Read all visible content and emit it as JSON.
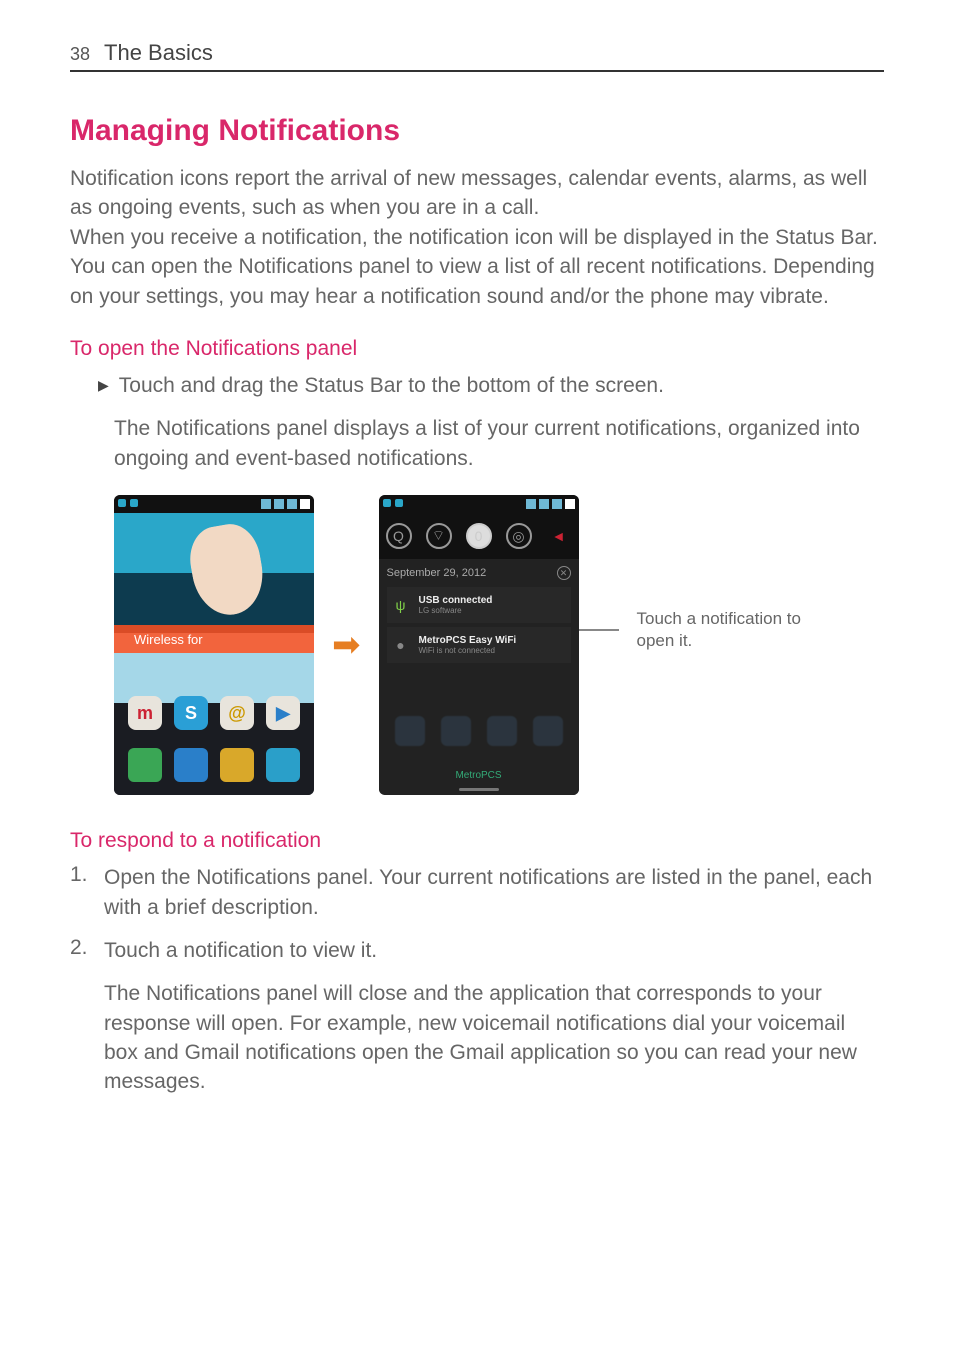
{
  "header": {
    "page_number": "38",
    "chapter": "The Basics"
  },
  "title": "Managing Notifications",
  "intro_para": "Notification icons report the arrival of new messages, calendar events, alarms, as well as ongoing events, such as when you are in a call.\nWhen you receive a notification, the notification icon will be displayed in the Status Bar. You can open the Notifications panel to view a list of all recent notifications. Depending on your settings, you may hear a notification sound and/or the phone may vibrate.",
  "section_open": {
    "heading": "To open the Notifications panel",
    "bullet": "Touch and drag the Status Bar to the bottom of the screen.",
    "followup": "The Notifications panel displays a list of your current notifications, organized into ongoing and event-based notifications."
  },
  "figure": {
    "phone1": {
      "wireless_label": "Wireless for"
    },
    "arrow": "➡",
    "phone2": {
      "date_label": "September 29, 2012",
      "notif1_title": "USB connected",
      "notif1_sub": "LG software",
      "notif2_title": "MetroPCS Easy WiFi",
      "notif2_sub": "WiFi is not connected",
      "carrier": "MetroPCS"
    },
    "callout": "Touch a notification to open it."
  },
  "section_respond": {
    "heading": "To respond to a notification",
    "step1": "Open the Notifications panel. Your current notifications are listed in the panel, each with a brief description.",
    "step2": "Touch a notification to view it.",
    "followup": "The Notifications panel will close and the application that corresponds to your response will open. For example, new voicemail notifications dial your voicemail box and Gmail notifications open the Gmail application so you can read your new messages."
  }
}
